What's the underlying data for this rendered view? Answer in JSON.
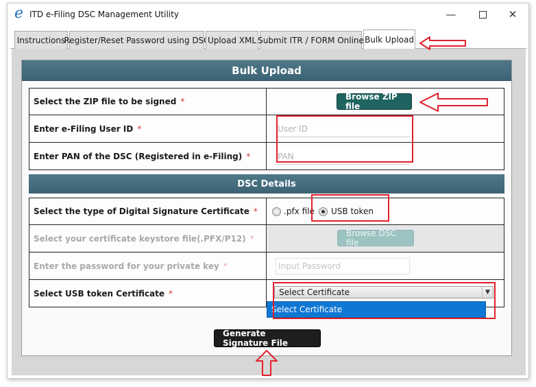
{
  "window": {
    "title": "ITD e-Filing DSC Management Utility",
    "icon": "e-logo-icon",
    "controls": {
      "minimize": "—",
      "close": "✕"
    }
  },
  "tabs": [
    {
      "label": "Instructions",
      "active": false
    },
    {
      "label": "Register/Reset Password using DSC",
      "active": false
    },
    {
      "label": "Upload XML",
      "active": false
    },
    {
      "label": "Submit ITR / FORM Online",
      "active": false
    },
    {
      "label": "Bulk Upload",
      "active": true
    }
  ],
  "panel": {
    "title": "Bulk Upload",
    "rows": {
      "zip": {
        "label": "Select the ZIP file to be signed",
        "button": "Browse ZIP file"
      },
      "userid": {
        "label": "Enter e-Filing User ID",
        "placeholder": "User ID"
      },
      "pan": {
        "label": "Enter PAN of the DSC (Registered in e-Filing)",
        "placeholder": "PAN"
      }
    },
    "required_mark": "*",
    "dsc_section": {
      "title": "DSC Details",
      "type_row": {
        "label": "Select the type of Digital Signature Certificate",
        "options": [
          {
            "label": ".pfx file",
            "selected": false
          },
          {
            "label": "USB token",
            "selected": true
          }
        ]
      },
      "keystore_row": {
        "label": "Select your certificate keystore file(.PFX/P12)",
        "button": "Browse DSC file",
        "disabled": true
      },
      "password_row": {
        "label": "Enter the password for your private key",
        "placeholder": "Input Password",
        "disabled": true
      },
      "usb_row": {
        "label": "Select USB token Certificate",
        "selected_value": "Select Certificate",
        "dropdown_options": [
          "Select Certificate"
        ]
      }
    },
    "generate_button": "Generate Signature File"
  },
  "colors": {
    "header_bg": "#456d7d",
    "teal_button": "#1f6460",
    "annotation_red": "#e0202a",
    "dropdown_highlight": "#0f77d4",
    "required_star": "#d0342c"
  }
}
